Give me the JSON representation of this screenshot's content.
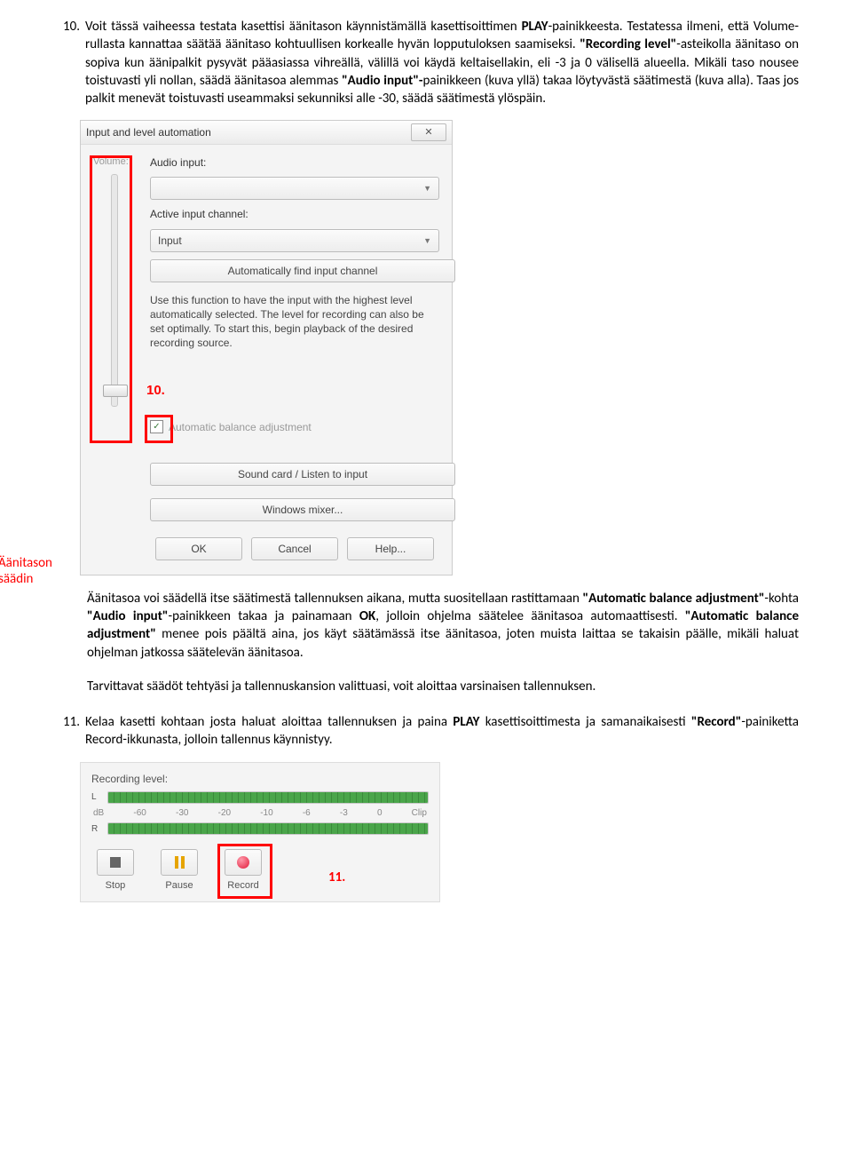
{
  "step10": {
    "num": "10.",
    "pre": "Voit tässä vaiheessa testata kasettisi äänitason käynnistämällä kasettisoittimen ",
    "play": "PLAY",
    "post1": "-painikkeesta. Testatessa ilmeni, että Volume-rullasta kannattaa säätää äänitaso kohtuullisen korkealle hyvän lopputuloksen saamiseksi. ",
    "rec_level": "\"Recording level\"",
    "post2": "-asteikolla äänitaso on sopiva kun äänipalkit pysyvät pääasiassa vihreällä, välillä voi käydä keltaisellakin, eli -3 ja 0 välisellä alueella. Mikäli taso nousee toistuvasti yli nollan, säädä äänitasoa alemmas ",
    "audio_input1": "\"Audio input\"-",
    "post3": "painikkeen (kuva yllä) takaa löytyvästä säätimestä (kuva alla). Taas jos palkit menevät toistuvasti useammaksi sekunniksi alle -30, säädä säätimestä ylöspäin."
  },
  "dialog": {
    "title": "Input and level automation",
    "vol": "Volume:",
    "audio_input": "Audio input:",
    "active_channel": "Active input channel:",
    "combo_val": "Input",
    "auto_find": "Automatically find input channel",
    "desc": "Use this function to have the input with the highest level automatically selected. The level for recording can also be set optimally. To start this, begin playback of the desired recording source.",
    "chk_label": "Automatic balance adjustment",
    "btn_sound": "Sound card / Listen to input",
    "btn_mixer": "Windows mixer...",
    "ok": "OK",
    "cancel": "Cancel",
    "help": "Help..."
  },
  "anno": {
    "ten": "10.",
    "side1": "Äänitason",
    "side2": "säädin",
    "eleven": "11."
  },
  "after": {
    "p1a": "Äänitasoa voi säädellä itse säätimestä tallennuksen aikana, mutta suositellaan rastittamaan ",
    "p1b": "\"Automatic balance adjustment\"",
    "p1c": "-kohta ",
    "p1d": "\"Audio input\"",
    "p1e": "-painikkeen takaa ja painamaan ",
    "p1f": "OK",
    "p1g": ", jolloin ohjelma säätelee äänitasoa automaattisesti. ",
    "p1h": "\"Automatic balance adjustment\"",
    "p1i": " menee pois päältä aina, jos käyt säätämässä itse äänitasoa, joten muista laittaa se takaisin päälle, mikäli haluat ohjelman jatkossa säätelevän äänitasoa.",
    "p2": "Tarvittavat säädöt tehtyäsi ja tallennuskansion valittuasi, voit aloittaa varsinaisen tallennuksen."
  },
  "step11": {
    "num": "11.",
    "t1": "Kelaa kasetti kohtaan josta haluat aloittaa tallennuksen ja paina ",
    "play": "PLAY",
    "t2": " kasettisoittimesta ja samanaikaisesti ",
    "rec": "\"Record\"",
    "t3": "-painiketta Record-ikkunasta, jolloin tallennus käynnistyy."
  },
  "recfig": {
    "reclevel": "Recording level:",
    "L": "L",
    "R": "R",
    "db": "dB",
    "ticks": [
      "-60",
      "-30",
      "-20",
      "-10",
      "-6",
      "-3",
      "0",
      "Clip"
    ],
    "stop": "Stop",
    "pause": "Pause",
    "record": "Record"
  }
}
